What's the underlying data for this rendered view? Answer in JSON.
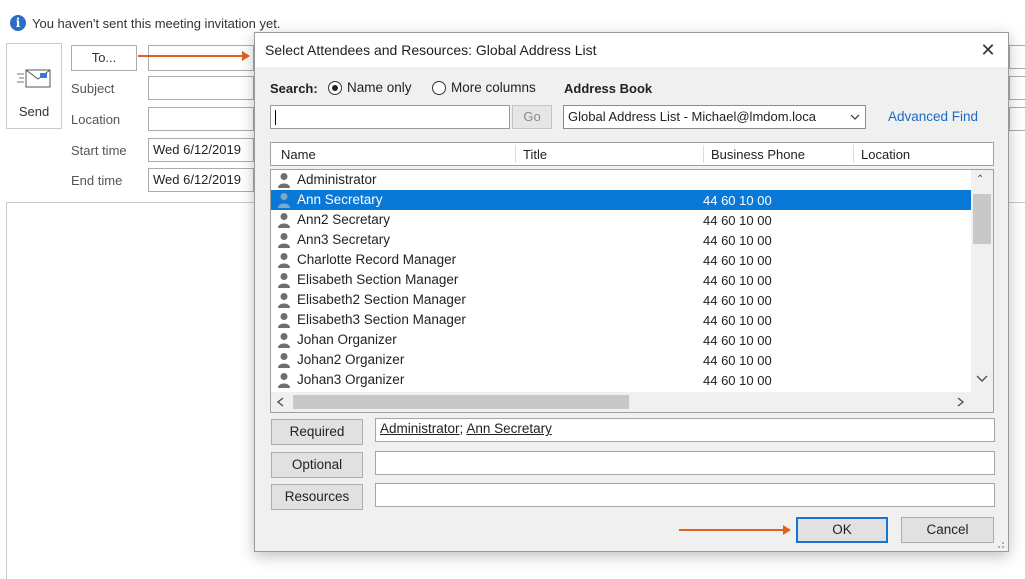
{
  "compose": {
    "info_text": "You haven't sent this meeting invitation yet.",
    "send_label": "Send",
    "to_button": "To...",
    "subject_label": "Subject",
    "location_label": "Location",
    "start_time_label": "Start time",
    "start_time_value": "Wed 6/12/2019",
    "end_time_label": "End time",
    "end_time_value": "Wed 6/12/2019"
  },
  "dialog": {
    "title": "Select Attendees and Resources: Global Address List",
    "search_label": "Search:",
    "radio_name_only": "Name only",
    "radio_more_columns": "More columns",
    "address_book_label": "Address Book",
    "search_value": "",
    "go_button": "Go",
    "address_book_value": "Global Address List - Michael@lmdom.loca",
    "advanced_find": "Advanced Find",
    "columns": [
      "Name",
      "Title",
      "Business Phone",
      "Location"
    ],
    "rows": [
      {
        "name": "Administrator",
        "phone": ""
      },
      {
        "name": "Ann Secretary",
        "phone": "44 60 10 00"
      },
      {
        "name": "Ann2 Secretary",
        "phone": "44 60 10 00"
      },
      {
        "name": "Ann3 Secretary",
        "phone": "44 60 10 00"
      },
      {
        "name": "Charlotte Record Manager",
        "phone": "44 60 10 00"
      },
      {
        "name": "Elisabeth Section Manager",
        "phone": "44 60 10 00"
      },
      {
        "name": "Elisabeth2 Section Manager",
        "phone": "44 60 10 00"
      },
      {
        "name": "Elisabeth3 Section Manager",
        "phone": "44 60 10 00"
      },
      {
        "name": "Johan Organizer",
        "phone": "44 60 10 00"
      },
      {
        "name": "Johan2 Organizer",
        "phone": "44 60 10 00"
      },
      {
        "name": "Johan3 Organizer",
        "phone": "44 60 10 00"
      }
    ],
    "selected_index": 1,
    "required_button": "Required",
    "required_value_1": "Administrator",
    "required_sep": ";",
    "required_value_2": "Ann Secretary",
    "optional_button": "Optional",
    "optional_value": "",
    "resources_button": "Resources",
    "resources_value": "",
    "ok_button": "OK",
    "cancel_button": "Cancel"
  },
  "colors": {
    "selection": "#0a78d7",
    "link": "#1a6bbf",
    "arrow": "#e0621e",
    "info_icon": "#2b6cc4"
  }
}
